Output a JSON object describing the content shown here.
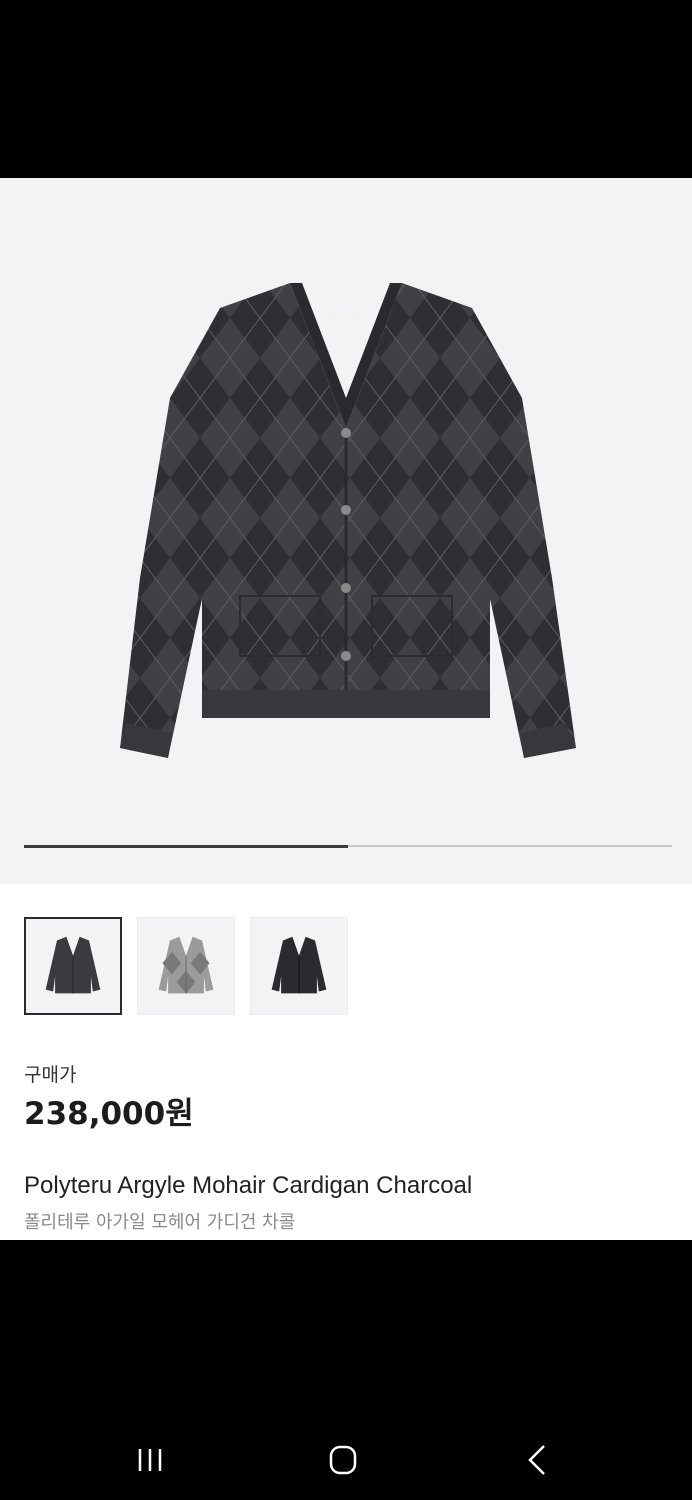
{
  "product": {
    "price_label": "구매가",
    "price": "238,000원",
    "title": "Polyteru Argyle Mohair Cardigan Charcoal",
    "subtitle": "폴리테루 아가일 모헤어 가디건 차콜"
  },
  "gallery": {
    "progress": 0.5,
    "thumbnails": [
      {
        "name": "charcoal cardigan",
        "color": "#3b3b3f",
        "selected": true
      },
      {
        "name": "grey cardigan",
        "color": "#9b9b9b",
        "selected": false
      },
      {
        "name": "black cardigan",
        "color": "#2b2b2f",
        "selected": false
      }
    ]
  },
  "colors": {
    "hero_bg": "#f3f2f4",
    "garment": "#3d3d41",
    "garment_dark": "#2c2c30"
  },
  "nav": {
    "recent_icon": "recent-apps-icon",
    "home_icon": "home-icon",
    "back_icon": "back-icon"
  }
}
